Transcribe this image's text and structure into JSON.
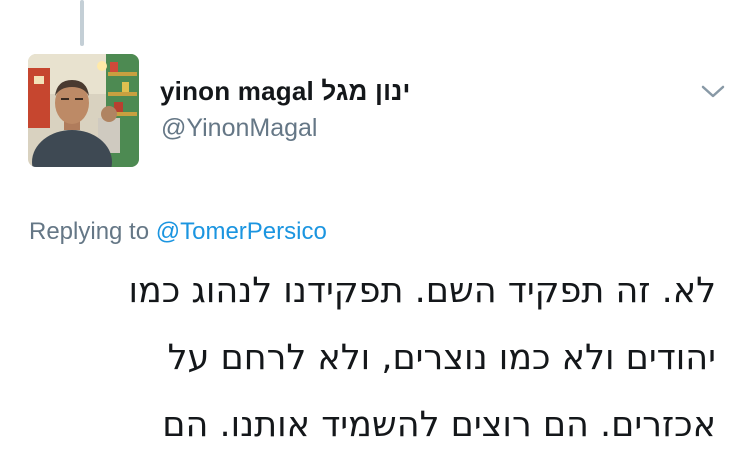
{
  "tweet": {
    "author": {
      "display_name": "yinon magal ינון מגל",
      "handle": "@YinonMagal"
    },
    "reply": {
      "prefix": "Replying to",
      "mention": "@TomerPersico"
    },
    "text_lines": [
      "לא. זה תפקיד השם. תפקידנו לנהוג כמו",
      "יהודים ולא כמו נוצרים, ולא לרחם על",
      "אכזרים. הם רוצים להשמיד אותנו. הם"
    ]
  },
  "icons": {
    "menu": "chevron-down-icon",
    "avatar": "profile-photo"
  },
  "colors": {
    "text_primary": "#14171a",
    "text_secondary": "#657786",
    "link": "#1b95e0",
    "thread_line": "#c4cfd6",
    "chevron": "#8899a6"
  }
}
